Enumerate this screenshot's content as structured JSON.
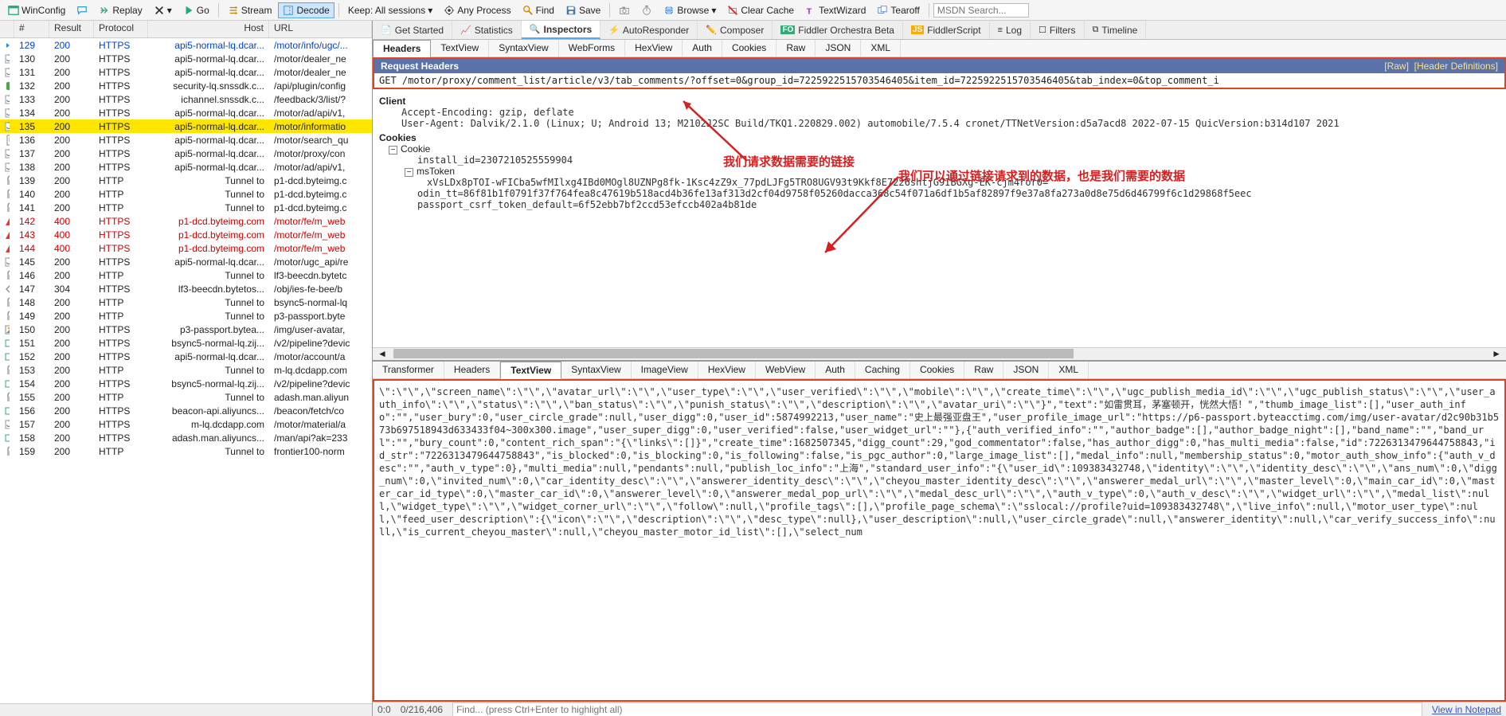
{
  "toolbar": {
    "winconfig": "WinConfig",
    "replay": "Replay",
    "go": "Go",
    "stream": "Stream",
    "decode": "Decode",
    "keep": "Keep: All sessions",
    "anyprocess": "Any Process",
    "find": "Find",
    "save": "Save",
    "browse": "Browse",
    "clearcache": "Clear Cache",
    "textwizard": "TextWizard",
    "tearoff": "Tearoff",
    "msdn_placeholder": "MSDN Search..."
  },
  "grid": {
    "headers": {
      "id": "#",
      "result": "Result",
      "protocol": "Protocol",
      "host": "Host",
      "url": "URL"
    },
    "rows": [
      {
        "ico": "dbl",
        "id": "129",
        "res": "200",
        "proto": "HTTPS",
        "host": "api5-normal-lq.dcar...",
        "url": "/motor/info/ugc/...",
        "cls": "blue"
      },
      {
        "ico": "js",
        "id": "130",
        "res": "200",
        "proto": "HTTPS",
        "host": "api5-normal-lq.dcar...",
        "url": "/motor/dealer_ne",
        "cls": "black"
      },
      {
        "ico": "js",
        "id": "131",
        "res": "200",
        "proto": "HTTPS",
        "host": "api5-normal-lq.dcar...",
        "url": "/motor/dealer_ne",
        "cls": "black"
      },
      {
        "ico": "core",
        "id": "132",
        "res": "200",
        "proto": "HTTPS",
        "host": "security-lq.snssdk.c...",
        "url": "/api/plugin/config",
        "cls": "black"
      },
      {
        "ico": "js",
        "id": "133",
        "res": "200",
        "proto": "HTTPS",
        "host": "ichannel.snssdk.c...",
        "url": "/feedback/3/list/?",
        "cls": "black"
      },
      {
        "ico": "js",
        "id": "134",
        "res": "200",
        "proto": "HTTPS",
        "host": "api5-normal-lq.dcar...",
        "url": "/motor/ad/api/v1,",
        "cls": "black"
      },
      {
        "ico": "js",
        "id": "135",
        "res": "200",
        "proto": "HTTPS",
        "host": "api5-normal-lq.dcar...",
        "url": "/motor/informatio",
        "cls": "black hl"
      },
      {
        "ico": "doc",
        "id": "136",
        "res": "200",
        "proto": "HTTPS",
        "host": "api5-normal-lq.dcar...",
        "url": "/motor/search_qu",
        "cls": "black"
      },
      {
        "ico": "js",
        "id": "137",
        "res": "200",
        "proto": "HTTPS",
        "host": "api5-normal-lq.dcar...",
        "url": "/motor/proxy/con",
        "cls": "black"
      },
      {
        "ico": "js",
        "id": "138",
        "res": "200",
        "proto": "HTTPS",
        "host": "api5-normal-lq.dcar...",
        "url": "/motor/ad/api/v1,",
        "cls": "black"
      },
      {
        "ico": "lock",
        "id": "139",
        "res": "200",
        "proto": "HTTP",
        "host": "Tunnel to",
        "url": "p1-dcd.byteimg.c",
        "cls": "black"
      },
      {
        "ico": "lock",
        "id": "140",
        "res": "200",
        "proto": "HTTP",
        "host": "Tunnel to",
        "url": "p1-dcd.byteimg.c",
        "cls": "black"
      },
      {
        "ico": "lock",
        "id": "141",
        "res": "200",
        "proto": "HTTP",
        "host": "Tunnel to",
        "url": "p1-dcd.byteimg.c",
        "cls": "black"
      },
      {
        "ico": "warn",
        "id": "142",
        "res": "400",
        "proto": "HTTPS",
        "host": "p1-dcd.byteimg.com",
        "url": "/motor/fe/m_web",
        "cls": "red"
      },
      {
        "ico": "warn",
        "id": "143",
        "res": "400",
        "proto": "HTTPS",
        "host": "p1-dcd.byteimg.com",
        "url": "/motor/fe/m_web",
        "cls": "red"
      },
      {
        "ico": "warn",
        "id": "144",
        "res": "400",
        "proto": "HTTPS",
        "host": "p1-dcd.byteimg.com",
        "url": "/motor/fe/m_web",
        "cls": "red"
      },
      {
        "ico": "js",
        "id": "145",
        "res": "200",
        "proto": "HTTPS",
        "host": "api5-normal-lq.dcar...",
        "url": "/motor/ugc_api/re",
        "cls": "black"
      },
      {
        "ico": "lock",
        "id": "146",
        "res": "200",
        "proto": "HTTP",
        "host": "Tunnel to",
        "url": "lf3-beecdn.bytetc",
        "cls": "black"
      },
      {
        "ico": "diamond",
        "id": "147",
        "res": "304",
        "proto": "HTTPS",
        "host": "lf3-beecdn.bytetos...",
        "url": "/obj/ies-fe-bee/b",
        "cls": "black"
      },
      {
        "ico": "lock",
        "id": "148",
        "res": "200",
        "proto": "HTTP",
        "host": "Tunnel to",
        "url": "bsync5-normal-lq",
        "cls": "black"
      },
      {
        "ico": "lock",
        "id": "149",
        "res": "200",
        "proto": "HTTP",
        "host": "Tunnel to",
        "url": "p3-passport.byte",
        "cls": "black"
      },
      {
        "ico": "img",
        "id": "150",
        "res": "200",
        "proto": "HTTPS",
        "host": "p3-passport.bytea...",
        "url": "/img/user-avatar,",
        "cls": "black"
      },
      {
        "ico": "send",
        "id": "151",
        "res": "200",
        "proto": "HTTPS",
        "host": "bsync5-normal-lq.zij...",
        "url": "/v2/pipeline?devic",
        "cls": "black"
      },
      {
        "ico": "send",
        "id": "152",
        "res": "200",
        "proto": "HTTPS",
        "host": "api5-normal-lq.dcar...",
        "url": "/motor/account/a",
        "cls": "black"
      },
      {
        "ico": "lock",
        "id": "153",
        "res": "200",
        "proto": "HTTP",
        "host": "Tunnel to",
        "url": "m-lq.dcdapp.com",
        "cls": "black"
      },
      {
        "ico": "send",
        "id": "154",
        "res": "200",
        "proto": "HTTPS",
        "host": "bsync5-normal-lq.zij...",
        "url": "/v2/pipeline?devic",
        "cls": "black"
      },
      {
        "ico": "lock",
        "id": "155",
        "res": "200",
        "proto": "HTTP",
        "host": "Tunnel to",
        "url": "adash.man.aliyun",
        "cls": "black"
      },
      {
        "ico": "send",
        "id": "156",
        "res": "200",
        "proto": "HTTPS",
        "host": "beacon-api.aliyuncs...",
        "url": "/beacon/fetch/co",
        "cls": "black"
      },
      {
        "ico": "js",
        "id": "157",
        "res": "200",
        "proto": "HTTPS",
        "host": "m-lq.dcdapp.com",
        "url": "/motor/material/a",
        "cls": "black"
      },
      {
        "ico": "send",
        "id": "158",
        "res": "200",
        "proto": "HTTPS",
        "host": "adash.man.aliyuncs...",
        "url": "/man/api?ak=233",
        "cls": "black"
      },
      {
        "ico": "lock",
        "id": "159",
        "res": "200",
        "proto": "HTTP",
        "host": "Tunnel to",
        "url": "frontier100-norm",
        "cls": "black"
      }
    ]
  },
  "main_tabs": [
    "Get Started",
    "Statistics",
    "Inspectors",
    "AutoResponder",
    "Composer",
    "Fiddler Orchestra Beta",
    "FiddlerScript",
    "Log",
    "Filters",
    "Timeline"
  ],
  "main_tab_active": 2,
  "req_tabs": [
    "Headers",
    "TextView",
    "SyntaxView",
    "WebForms",
    "HexView",
    "Auth",
    "Cookies",
    "Raw",
    "JSON",
    "XML"
  ],
  "req_tab_active": 0,
  "req_header_bar": {
    "title": "Request Headers",
    "raw": "[Raw]",
    "defs": "[Header Definitions]"
  },
  "request_line": "GET /motor/proxy/comment_list/article/v3/tab_comments/?offset=0&group_id=7225922515703546405&item_id=7225922515703546405&tab_index=0&top_comment_i",
  "req_headers": {
    "client_label": "Client",
    "accept_encoding": "Accept-Encoding: gzip, deflate",
    "user_agent": "User-Agent: Dalvik/2.1.0 (Linux; U; Android 13; M2102J2SC Build/TKQ1.220829.002) automobile/7.5.4 cronet/TTNetVersion:d5a7acd8 2022-07-15 QuicVersion:b314d107 2021",
    "cookies_label": "Cookies",
    "cookie_label": "Cookie",
    "install_id": "install_id=2307210525559904",
    "mstoken_label": "msToken",
    "mstoken_val": "xVsLDx8pTOI-wFICba5wfMIlxg4IBd0MOgl8UZNPg8fk-1Ksc4zZ9x_77pdLJFg5TRO8UGV93t9Kkf8E7226shtjG9IBGXg-EK-cjm4ror0=",
    "odin_tt": "odin_tt=86f81b1f0791f37f764fea8c47619b518acd4b36fe13af313d2cf04d9758f05260dacca368c54f071a6df1b5af82897f9e37a8fa273a0d8e75d6d46799f6c1d29868f5eec",
    "passport": "passport_csrf_token_default=6f52ebb7bf2ccd53efccb402a4b81de"
  },
  "annotations": {
    "a1": "我们请求数据需要的链接",
    "a2": "我们可以通过链接请求到的数据，也是我们需要的数据"
  },
  "resp_tabs": [
    "Transformer",
    "Headers",
    "TextView",
    "SyntaxView",
    "ImageView",
    "HexView",
    "WebView",
    "Auth",
    "Caching",
    "Cookies",
    "Raw",
    "JSON",
    "XML"
  ],
  "resp_tab_active": 2,
  "response_text": "\\\":\\\"\\\",\\\"screen_name\\\":\\\"\\\",\\\"avatar_url\\\":\\\"\\\",\\\"user_type\\\":\\\"\\\",\\\"user_verified\\\":\\\"\\\",\\\"mobile\\\":\\\"\\\",\\\"create_time\\\":\\\"\\\",\\\"ugc_publish_media_id\\\":\\\"\\\",\\\"ugc_publish_status\\\":\\\"\\\",\\\"user_auth_info\\\":\\\"\\\",\\\"status\\\":\\\"\\\",\\\"ban_status\\\":\\\"\\\",\\\"punish_status\\\":\\\"\\\",\\\"description\\\":\\\"\\\",\\\"avatar_uri\\\":\\\"\\\"}\",\"text\":\"如雷贯耳，茅塞顿开，恍然大悟！\",\"thumb_image_list\":[],\"user_auth_info\":\"\",\"user_bury\":0,\"user_circle_grade\":null,\"user_digg\":0,\"user_id\":5874992213,\"user_name\":\"史上最强亚盘王\",\"user_profile_image_url\":\"https://p6-passport.byteacctimg.com/img/user-avatar/d2c90b31b573b697518943d633433f04~300x300.image\",\"user_super_digg\":0,\"user_verified\":false,\"user_widget_url\":\"\"},{\"auth_verified_info\":\"\",\"author_badge\":[],\"author_badge_night\":[],\"band_name\":\"\",\"band_url\":\"\",\"bury_count\":0,\"content_rich_span\":\"{\\\"links\\\":[]}\",\"create_time\":1682507345,\"digg_count\":29,\"god_commentator\":false,\"has_author_digg\":0,\"has_multi_media\":false,\"id\":7226313479644758843,\"id_str\":\"7226313479644758843\",\"is_blocked\":0,\"is_blocking\":0,\"is_following\":false,\"is_pgc_author\":0,\"large_image_list\":[],\"medal_info\":null,\"membership_status\":0,\"motor_auth_show_info\":{\"auth_v_desc\":\"\",\"auth_v_type\":0},\"multi_media\":null,\"pendants\":null,\"publish_loc_info\":\"上海\",\"standard_user_info\":\"{\\\"user_id\\\":109383432748,\\\"identity\\\":\\\"\\\",\\\"identity_desc\\\":\\\"\\\",\\\"ans_num\\\":0,\\\"digg_num\\\":0,\\\"invited_num\\\":0,\\\"car_identity_desc\\\":\\\"\\\",\\\"answerer_identity_desc\\\":\\\"\\\",\\\"cheyou_master_identity_desc\\\":\\\"\\\",\\\"answerer_medal_url\\\":\\\"\\\",\\\"master_level\\\":0,\\\"main_car_id\\\":0,\\\"master_car_id_type\\\":0,\\\"master_car_id\\\":0,\\\"answerer_level\\\":0,\\\"answerer_medal_pop_url\\\":\\\"\\\",\\\"medal_desc_url\\\":\\\"\\\",\\\"auth_v_type\\\":0,\\\"auth_v_desc\\\":\\\"\\\",\\\"widget_url\\\":\\\"\\\",\\\"medal_list\\\":null,\\\"widget_type\\\":\\\"\\\",\\\"widget_corner_url\\\":\\\"\\\",\\\"follow\\\":null,\\\"profile_tags\\\":[],\\\"profile_page_schema\\\":\\\"sslocal://profile?uid=109383432748\\\",\\\"live_info\\\":null,\\\"motor_user_type\\\":null,\\\"feed_user_description\\\":{\\\"icon\\\":\\\"\\\",\\\"description\\\":\\\"\\\",\\\"desc_type\\\":null},\\\"user_description\\\":null,\\\"user_circle_grade\\\":null,\\\"answerer_identity\\\":null,\\\"car_verify_success_info\\\":null,\\\"is_current_cheyou_master\\\":null,\\\"cheyou_master_motor_id_list\\\":[],\\\"select_num",
  "statusbar": {
    "pos": "0:0",
    "bytes": "0/216,406",
    "find": "Find... (press Ctrl+Enter to highlight all)",
    "notepad": "View in Notepad"
  }
}
